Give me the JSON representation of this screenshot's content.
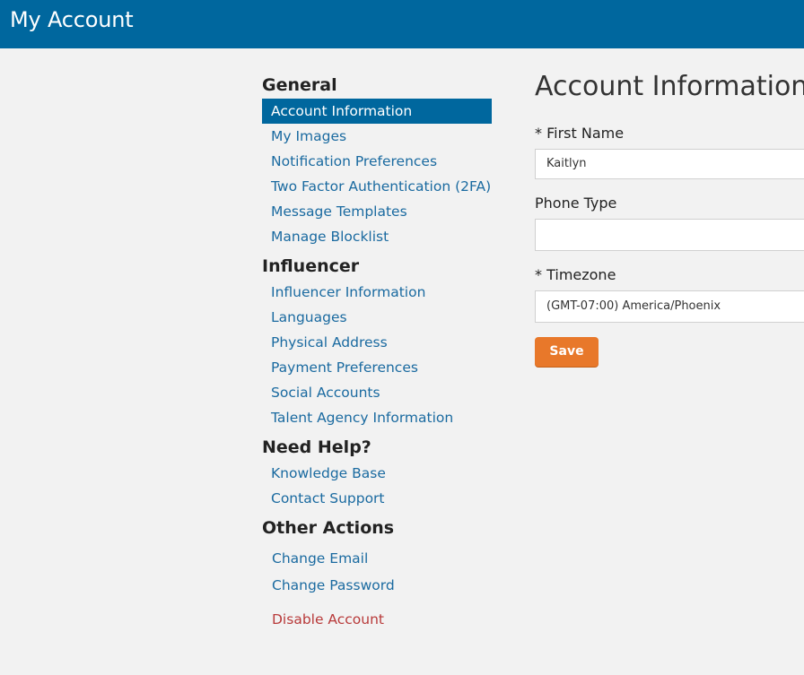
{
  "header": {
    "title": "My Account"
  },
  "nav": {
    "general": {
      "title": "General",
      "items": [
        "Account Information",
        "My Images",
        "Notification Preferences",
        "Two Factor Authentication (2FA)",
        "Message Templates",
        "Manage Blocklist"
      ]
    },
    "influencer": {
      "title": "Influencer",
      "items": [
        "Influencer Information",
        "Languages",
        "Physical Address",
        "Payment Preferences",
        "Social Accounts",
        "Talent Agency Information"
      ]
    },
    "help": {
      "title": "Need Help?",
      "items": [
        "Knowledge Base",
        "Contact Support"
      ]
    },
    "other": {
      "title": "Other Actions",
      "items": [
        "Change Email",
        "Change Password",
        "Disable Account"
      ]
    }
  },
  "main": {
    "title": "Account Information",
    "fields": {
      "first_name": {
        "label": "* First Name",
        "value": "Kaitlyn"
      },
      "phone_type": {
        "label": "Phone Type",
        "value": ""
      },
      "timezone": {
        "label": "* Timezone",
        "value": "(GMT-07:00) America/Phoenix"
      }
    },
    "save_label": "Save"
  },
  "colors": {
    "header_bg": "#00679e",
    "link": "#1a6aa0",
    "active_bg": "#00679e",
    "danger": "#b83a3a",
    "save_bg": "#e8782a"
  }
}
